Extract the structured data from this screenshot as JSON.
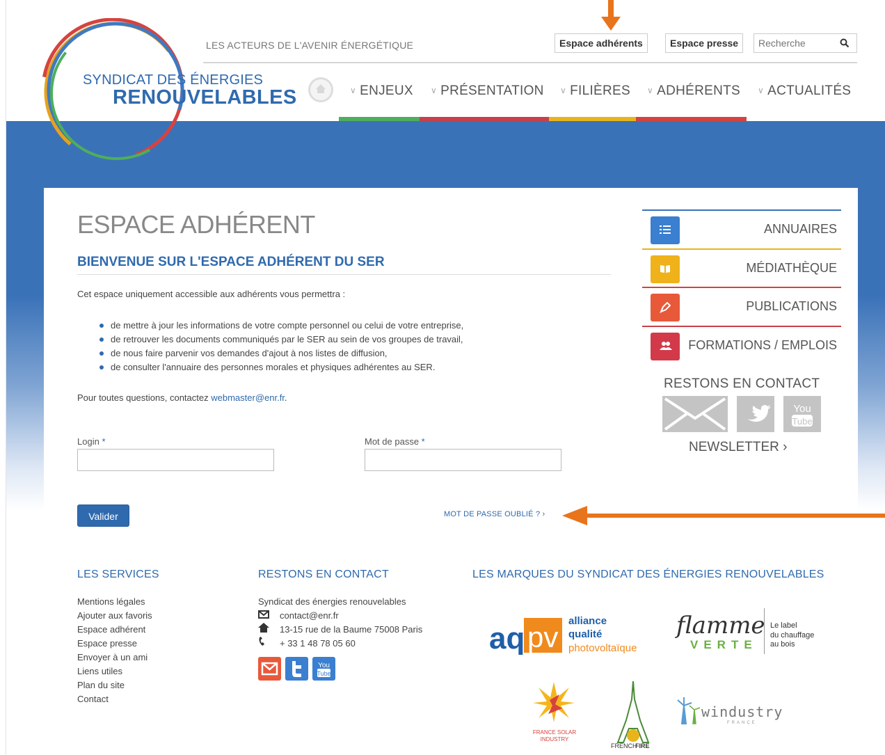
{
  "logo": {
    "line1": "SYNDICAT DES ÉNERGIES",
    "line2": "RENOUVELABLES",
    "ring_colors": [
      "#e8a21c",
      "#d6433e",
      "#3f7ac2",
      "#4fae5a"
    ]
  },
  "header": {
    "tagline": "LES ACTEURS DE L'AVENIR ÉNERGÉTIQUE",
    "btn_members": "Espace adhérents",
    "btn_press": "Espace presse",
    "search_placeholder": "Recherche"
  },
  "nav": {
    "items": [
      "ENJEUX",
      "PRÉSENTATION",
      "FILIÈRES",
      "ADHÉRENTS",
      "ACTUALITÉS"
    ],
    "bar_colors": [
      "#4fae5a",
      "#c8404a",
      "#e8b41c",
      "#d6433e"
    ]
  },
  "main": {
    "title": "ESPACE ADHÉRENT",
    "subtitle": "BIENVENUE SUR L'ESPACE ADHÉRENT DU SER",
    "intro": "Cet espace uniquement accessible aux adhérents vous permettra :",
    "bullets": [
      "de mettre à jour les informations de votre compte personnel ou celui de votre entreprise,",
      "de retrouver les documents communiqués par le SER au sein de vos groupes de travail,",
      "de nous faire parvenir vos demandes d'ajout à nos listes de diffusion,",
      "de consulter l'annuaire des personnes morales et physiques adhérentes au SER."
    ],
    "contact_prefix": "Pour toutes questions, contactez ",
    "contact_email": "webmaster@enr.fr",
    "contact_suffix": ".",
    "login_label": "Login",
    "password_label": "Mot de passe",
    "required_mark": "*",
    "submit": "Valider",
    "forgot": "MOT DE PASSE OUBLIÉ ?"
  },
  "sidebar": {
    "items": [
      {
        "label": "ANNUAIRES",
        "color": "#3a7fd0",
        "bar": "#3a72b8"
      },
      {
        "label": "MÉDIATHÈQUE",
        "color": "#f0b21a",
        "bar": "#e8b41c"
      },
      {
        "label": "PUBLICATIONS",
        "color": "#e8593a",
        "bar": "#d6433e"
      },
      {
        "label": "FORMATIONS / EMPLOIS",
        "color": "#d23a4a",
        "bar": "#c8404a"
      }
    ],
    "stay_title": "RESTONS EN CONTACT",
    "newsletter": "NEWSLETTER",
    "youtube_line1": "You",
    "youtube_line2": "Tube"
  },
  "footer": {
    "services_title": "LES SERVICES",
    "services": [
      "Mentions légales",
      "Ajouter aux favoris",
      "Espace adhérent",
      "Espace presse",
      "Envoyer à un ami",
      "Liens utiles",
      "Plan du site",
      "Contact"
    ],
    "contact_title": "RESTONS EN CONTACT",
    "org": "Syndicat des énergies renouvelables",
    "email": "contact@enr.fr",
    "address": "13-15 rue de la Baume 75008 Paris",
    "phone": "+ 33 1 48 78 05 60",
    "brands_title": "LES MARQUES DU SYNDICAT DES ÉNERGIES RENOUVELABLES",
    "brands": {
      "aqpv_a": "aq",
      "aqpv_b": "pv",
      "aqpv_l1": "alliance",
      "aqpv_l2": "qualité",
      "aqpv_l3": "photovoltaïque",
      "flamme_1": "flamme",
      "flamme_2": "VERTE",
      "flamme_t1": "Le label",
      "flamme_t2": "du chauffage",
      "flamme_t3": "au bois",
      "fsi_1": "FRANCE SOLAR",
      "fsi_2": "INDUSTRY",
      "ff_1": "FRENCH",
      "ff_2": "FIRE",
      "windustry": "windustry",
      "windustry_sub": "FRANCE"
    }
  },
  "colors": {
    "accent": "#2f6aae",
    "annotation": "#e8741c"
  }
}
